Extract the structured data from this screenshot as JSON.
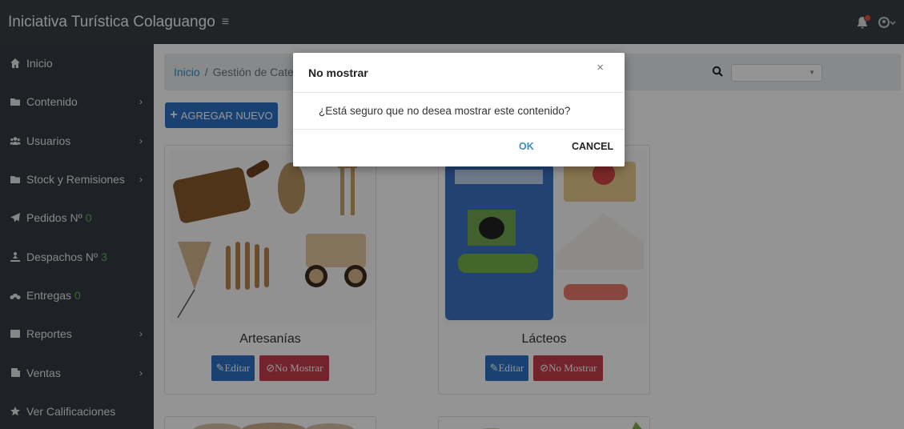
{
  "header": {
    "title": "Iniciativa Turística Colaguango",
    "menu_icon": "hamburger-icon"
  },
  "sidebar": {
    "items": [
      {
        "label": "Inicio",
        "icon": "home-icon"
      },
      {
        "label": "Contenido",
        "icon": "folder-icon"
      },
      {
        "label": "Usuarios",
        "icon": "users-icon"
      },
      {
        "label": "Stock y Remisiones",
        "icon": "folder-icon"
      },
      {
        "label": "Pedidos Nº",
        "count": "0",
        "icon": "send-icon"
      },
      {
        "label": "Despachos Nº",
        "count": "3",
        "icon": "dispatch-icon"
      },
      {
        "label": "Entregas",
        "count": "0",
        "icon": "bike-icon"
      },
      {
        "label": "Reportes",
        "icon": "report-icon"
      },
      {
        "label": "Ventas",
        "icon": "sales-icon"
      },
      {
        "label": "Ver Calificaciones",
        "icon": "star-icon"
      }
    ]
  },
  "breadcrumb": {
    "home": "Inicio",
    "separator": "/",
    "current": "Gestión de Categ"
  },
  "toolbar": {
    "add_label": "AGREGAR NUEVO"
  },
  "cards": [
    {
      "title": "Artesanías",
      "edit_label": "Editar",
      "hide_label": "No Mostrar"
    },
    {
      "title": "Lácteos",
      "edit_label": "Editar",
      "hide_label": "No Mostrar"
    }
  ],
  "modal": {
    "title": "No mostrar",
    "close": "×",
    "message": "¿Está seguro que no desea mostrar este contenido?",
    "ok_label": "OK",
    "cancel_label": "CANCEL"
  },
  "colors": {
    "topbar": "#3a3f44",
    "sidebar": "#343a40",
    "primary": "#2b73c7",
    "danger": "#c63d4c",
    "link": "#3c8dbc",
    "badge_count": "#5cb85c"
  }
}
